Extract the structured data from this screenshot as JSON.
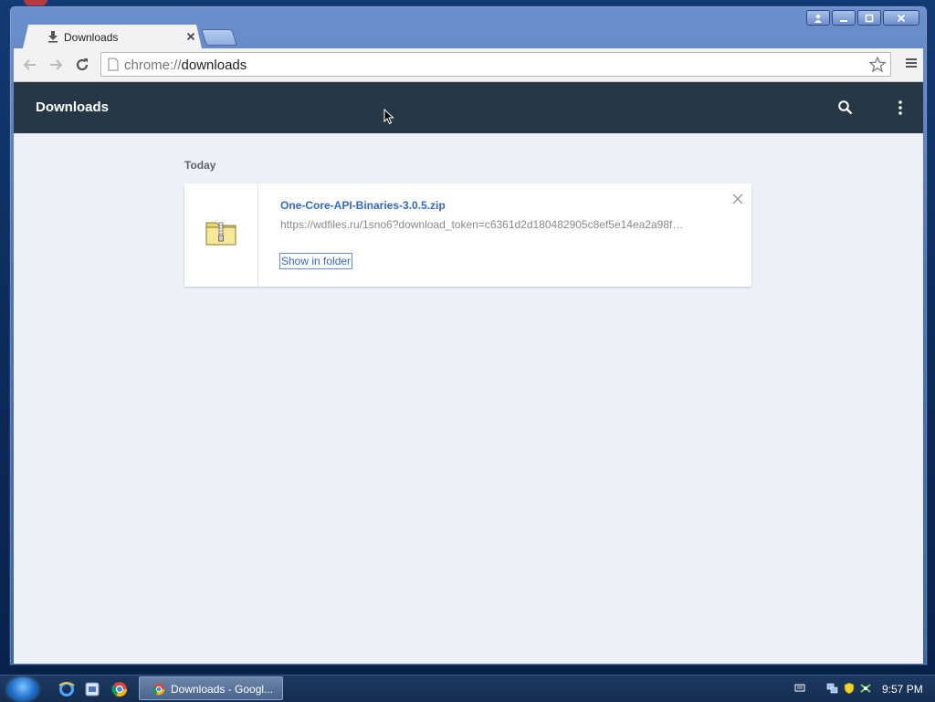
{
  "browser": {
    "tab_title": "Downloads",
    "address_scheme": "chrome://",
    "address_path": "downloads"
  },
  "page": {
    "title": "Downloads",
    "section_label": "Today",
    "downloads": [
      {
        "file_name": "One-Core-API-Binaries-3.0.5.zip",
        "url": "https://wdfiles.ru/1sno6?download_token=c6361d2d180482905c8ef5e14ea2a98f…",
        "action_label": "Show in folder"
      }
    ]
  },
  "taskbar": {
    "active_window_label": "Downloads - Googl...",
    "clock": "9:57 PM"
  },
  "icons": {
    "tab": "download-icon",
    "back": "back-arrow-icon",
    "forward": "forward-arrow-icon",
    "reload": "reload-icon",
    "page": "page-icon",
    "bookmark": "star-icon",
    "menu": "hamburger-menu-icon",
    "search": "search-icon",
    "more": "more-vert-icon",
    "file": "zip-folder-icon",
    "remove": "close-icon"
  },
  "colors": {
    "header_bg": "#263846",
    "page_bg": "#eef0f8",
    "link_blue": "#3367d6"
  }
}
